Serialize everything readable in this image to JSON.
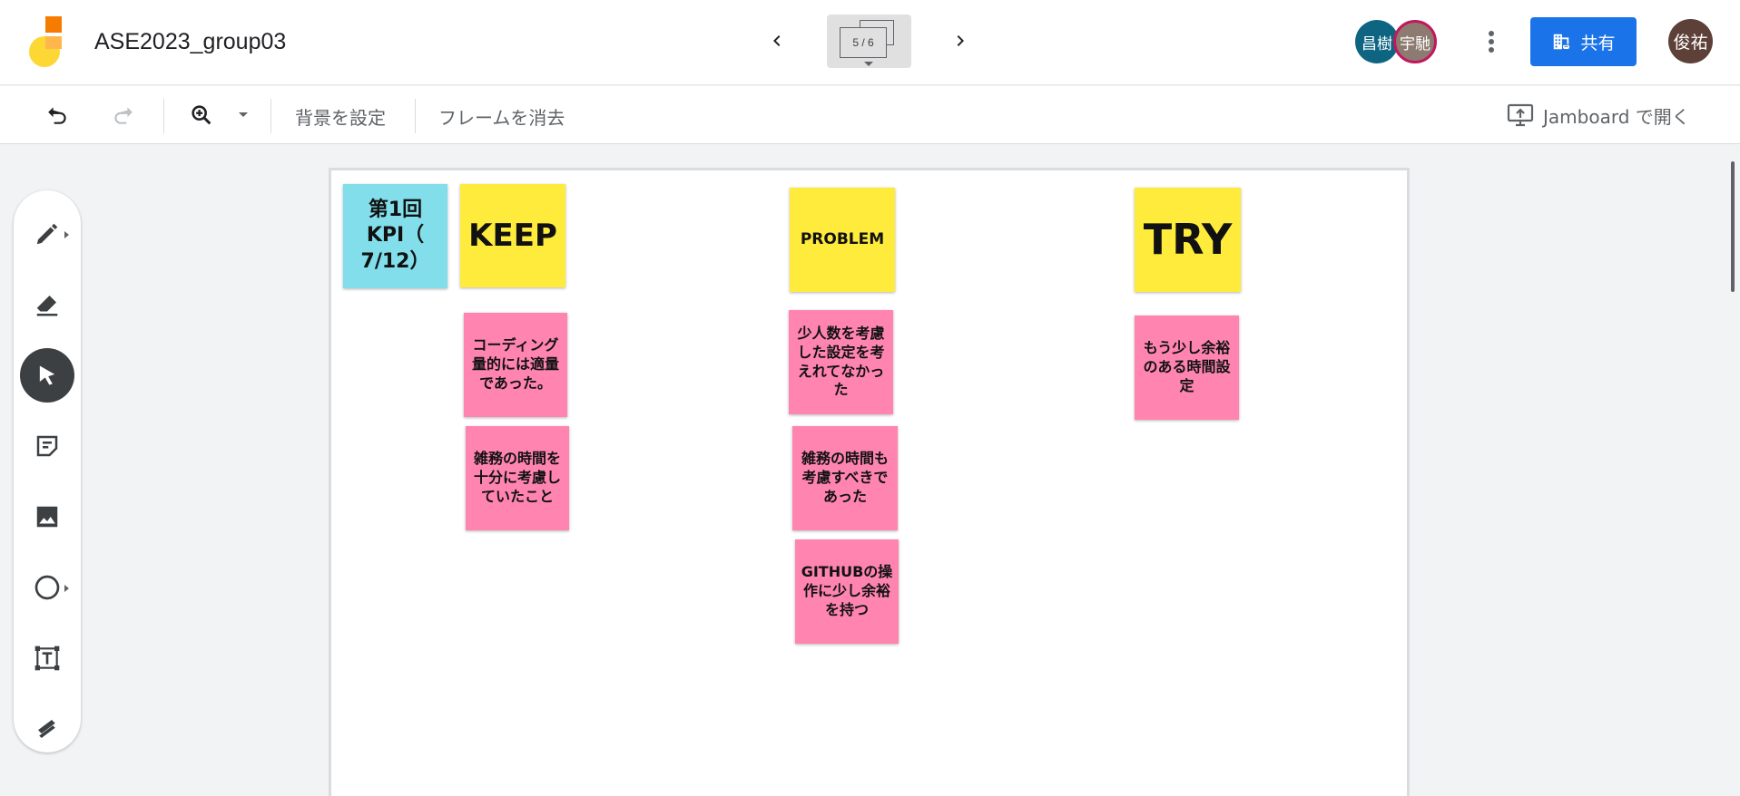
{
  "header": {
    "title": "ASE2023_group03",
    "frame_counter": "5 / 6",
    "avatars": [
      "昌樹",
      "宇馳"
    ],
    "share_label": "共有",
    "user_avatar": "俊祐"
  },
  "toolbar": {
    "set_background": "背景を設定",
    "clear_frame": "フレームを消去",
    "open_in_jamboard": "Jamboard で開く"
  },
  "tools": [
    "pen-icon",
    "eraser-icon",
    "select-icon",
    "sticky-note-icon",
    "image-icon",
    "shape-icon",
    "text-box-icon",
    "laser-icon"
  ],
  "board": {
    "notes": [
      {
        "id": "kpi",
        "text": "第1回\nKPI（\n7/12）",
        "color": "cyan"
      },
      {
        "id": "keep",
        "text": "KEEP",
        "color": "yellow"
      },
      {
        "id": "problem",
        "text": "PROBLEM",
        "color": "yellow"
      },
      {
        "id": "try",
        "text": "TRY",
        "color": "yellow"
      },
      {
        "id": "keep1",
        "text": "コーディング量的には適量であった。",
        "color": "pink"
      },
      {
        "id": "keep2",
        "text": "雑務の時間を十分に考慮していたこと",
        "color": "pink"
      },
      {
        "id": "problem1",
        "text": "少人数を考慮した設定を考えれてなかった",
        "color": "pink"
      },
      {
        "id": "problem2",
        "text": "雑務の時間も考慮すべきであった",
        "color": "pink"
      },
      {
        "id": "problem3",
        "text": "GITHUBの操作に少し余裕を持つ",
        "color": "pink"
      },
      {
        "id": "try1",
        "text": "もう少し余裕のある時間設定",
        "color": "pink"
      }
    ]
  },
  "colors": {
    "share_button": "#1a73e8",
    "sticky_yellow": "#ffeb3b",
    "sticky_pink": "#ff85b0",
    "sticky_cyan": "#81deea"
  }
}
